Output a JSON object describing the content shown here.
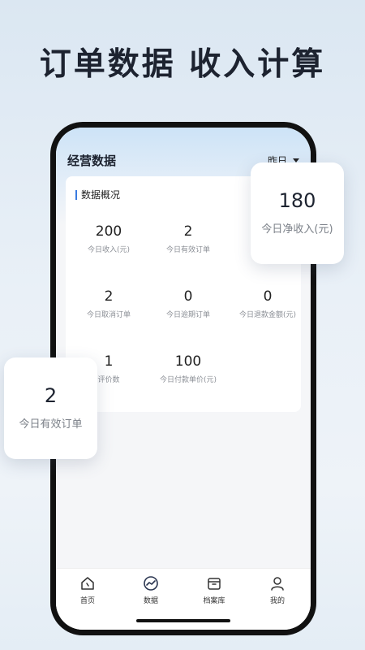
{
  "headline": "订单数据 收入计算",
  "app": {
    "title": "经营数据",
    "date_filter": "昨日"
  },
  "overview": {
    "title": "数据概况",
    "stats": [
      {
        "value": "200",
        "label": "今日收入(元)"
      },
      {
        "value": "2",
        "label": "今日有效订单"
      },
      {
        "value": "",
        "label": "今日"
      },
      {
        "value": "2",
        "label": "今日取消订单"
      },
      {
        "value": "0",
        "label": "今日逾期订单"
      },
      {
        "value": "0",
        "label": "今日退款金额(元)"
      },
      {
        "value": "1",
        "label": "评价数"
      },
      {
        "value": "100",
        "label": "今日付款单价(元)"
      }
    ]
  },
  "nav": {
    "items": [
      {
        "label": "首页",
        "icon": "home-icon"
      },
      {
        "label": "数据",
        "icon": "chart-icon"
      },
      {
        "label": "档案库",
        "icon": "archive-icon"
      },
      {
        "label": "我的",
        "icon": "user-icon"
      }
    ]
  },
  "callouts": {
    "right": {
      "value": "180",
      "label": "今日净收入(元)"
    },
    "left": {
      "value": "2",
      "label": "今日有效订单"
    }
  },
  "colors": {
    "accent": "#3a7be0",
    "text": "#1d2330"
  }
}
